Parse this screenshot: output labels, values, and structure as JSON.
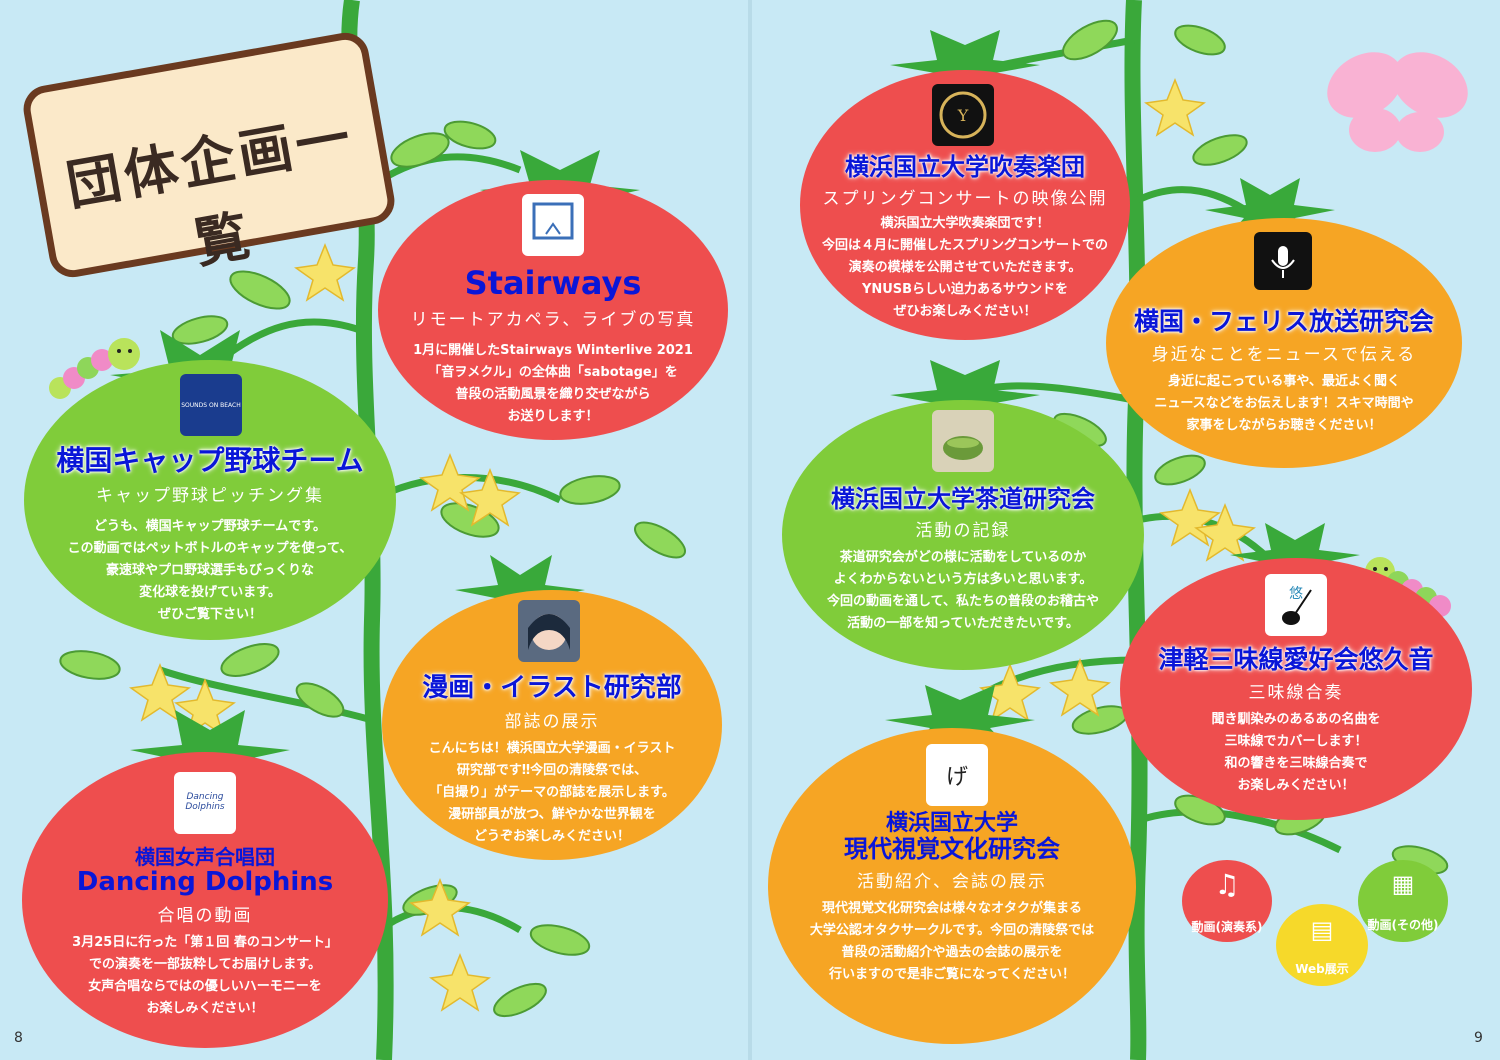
{
  "heading": "団体企画一覧",
  "pages": {
    "left": "8",
    "right": "9"
  },
  "groups": {
    "stairways": {
      "title": "Stairways",
      "subtitle": "リモートアカペラ、ライブの写真",
      "lines": [
        "1月に開催したStairways Winterlive 2021",
        "「音ヲメクル」の全体曲「sabotage」を",
        "普段の活動風景を織り交ぜながら",
        "お送りします！"
      ]
    },
    "cap": {
      "logo_text": "SOUNDS ON BEACH",
      "title": "横国キャップ野球チーム",
      "subtitle": "キャップ野球ピッチング集",
      "lines": [
        "どうも、横国キャップ野球チームです。",
        "この動画ではペットボトルのキャップを使って、",
        "豪速球やプロ野球選手もびっくりな",
        "変化球を投げています。",
        "ぜひご覧下さい！"
      ]
    },
    "manga": {
      "title": "漫画・イラスト研究部",
      "subtitle": "部誌の展示",
      "lines": [
        "こんにちは！横浜国立大学漫画・イラスト",
        "研究部です‼今回の清陵祭では、",
        "「自撮り」がテーマの部誌を展示します。",
        "漫研部員が放つ、鮮やかな世界観を",
        "どうぞお楽しみください！"
      ]
    },
    "dolphins": {
      "logo_text": "Dancing Dolphins",
      "title1": "横国女声合唱団",
      "title2": "Dancing Dolphins",
      "subtitle": "合唱の動画",
      "lines": [
        "3月25日に行った「第１回 春のコンサート」",
        "での演奏を一部抜粋してお届けします。",
        "女声合唱ならではの優しいハーモニーを",
        "お楽しみください！"
      ]
    },
    "band": {
      "title": "横浜国立大学吹奏楽団",
      "subtitle": "スプリングコンサートの映像公開",
      "lines": [
        "横浜国立大学吹奏楽団です！",
        "今回は４月に開催したスプリングコンサートでの",
        "演奏の模様を公開させていただきます。",
        "YNUSBらしい迫力あるサウンドを",
        "ぜひお楽しみください！"
      ]
    },
    "broadcast": {
      "title": "横国・フェリス放送研究会",
      "subtitle": "身近なことをニュースで伝える",
      "lines": [
        "身近に起こっている事や、最近よく聞く",
        "ニュースなどをお伝えします！スキマ時間や",
        "家事をしながらお聴きください！"
      ]
    },
    "tea": {
      "title": "横浜国立大学茶道研究会",
      "subtitle": "活動の記録",
      "lines": [
        "茶道研究会がどの様に活動をしているのか",
        "よくわからないという方は多いと思います。",
        "今回の動画を通して、私たちの普段のお稽古や",
        "活動の一部を知っていただきたいです。"
      ]
    },
    "shamisen": {
      "title": "津軽三味線愛好会悠久音",
      "subtitle": "三味線合奏",
      "lines": [
        "聞き馴染みのあるあの名曲を",
        "三味線でカバーします！",
        "和の響きを三味線合奏で",
        "お楽しみください！"
      ]
    },
    "visual": {
      "title1": "横浜国立大学",
      "title2": "現代視覚文化研究会",
      "subtitle": "活動紹介、会誌の展示",
      "lines": [
        "現代視覚文化研究会は様々なオタクが集まる",
        "大学公認オタクサークルです。今回の清陵祭では",
        "普段の活動紹介や過去の会誌の展示を",
        "行いますので是非ご覧になってください！"
      ]
    }
  },
  "legend": {
    "music": "動画(演奏系)",
    "web": "Web展示",
    "other": "動画(その他)"
  },
  "colors": {
    "background": "#c8e9f5",
    "red_tomato": "#ee4e4e",
    "green_tomato": "#80cc3a",
    "orange_tomato": "#f6a524",
    "title_blue": "#0a16d8",
    "stem": "#39a93a",
    "leaf": "#8fd85a",
    "flower": "#f7e36a"
  }
}
